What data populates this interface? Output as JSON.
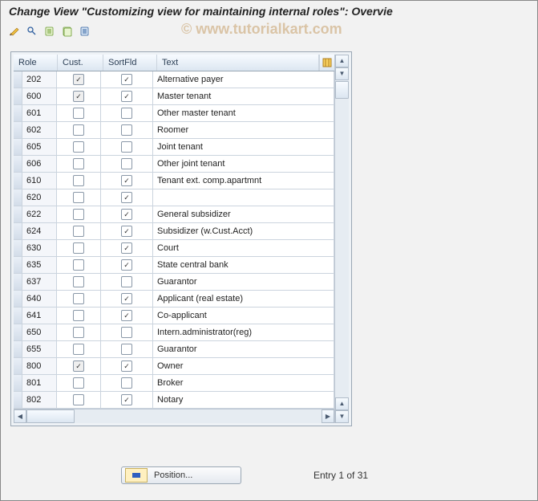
{
  "title": "Change View \"Customizing view for maintaining internal roles\": Overvie",
  "watermark": "© www.tutorialkart.com",
  "toolbar": {
    "items": [
      {
        "name": "toggle-change-icon"
      },
      {
        "name": "new-entries-icon"
      },
      {
        "name": "copy-as-icon"
      },
      {
        "name": "save-icon"
      },
      {
        "name": "select-all-icon"
      }
    ]
  },
  "columns": {
    "role": "Role",
    "cust": "Cust.",
    "sort": "SortFld",
    "text": "Text"
  },
  "rows": [
    {
      "role": "202",
      "cust": true,
      "cust_disabled": true,
      "sort": true,
      "text": "Alternative payer"
    },
    {
      "role": "600",
      "cust": true,
      "cust_disabled": true,
      "sort": true,
      "text": "Master tenant"
    },
    {
      "role": "601",
      "cust": false,
      "sort": false,
      "text": "Other master tenant"
    },
    {
      "role": "602",
      "cust": false,
      "sort": false,
      "text": "Roomer"
    },
    {
      "role": "605",
      "cust": false,
      "sort": false,
      "text": "Joint tenant"
    },
    {
      "role": "606",
      "cust": false,
      "sort": false,
      "text": "Other joint tenant"
    },
    {
      "role": "610",
      "cust": false,
      "sort": true,
      "text": "Tenant ext. comp.apartmnt"
    },
    {
      "role": "620",
      "cust": false,
      "sort": true,
      "text": ""
    },
    {
      "role": "622",
      "cust": false,
      "sort": true,
      "text": "General subsidizer"
    },
    {
      "role": "624",
      "cust": false,
      "sort": true,
      "text": "Subsidizer (w.Cust.Acct)"
    },
    {
      "role": "630",
      "cust": false,
      "sort": true,
      "text": "Court"
    },
    {
      "role": "635",
      "cust": false,
      "sort": true,
      "text": "State central bank"
    },
    {
      "role": "637",
      "cust": false,
      "sort": false,
      "text": "Guarantor"
    },
    {
      "role": "640",
      "cust": false,
      "sort": true,
      "text": "Applicant (real estate)"
    },
    {
      "role": "641",
      "cust": false,
      "sort": true,
      "text": "Co-applicant"
    },
    {
      "role": "650",
      "cust": false,
      "sort": false,
      "text": "Intern.administrator(reg)"
    },
    {
      "role": "655",
      "cust": false,
      "sort": false,
      "text": "Guarantor"
    },
    {
      "role": "800",
      "cust": true,
      "cust_disabled": true,
      "sort": true,
      "text": "Owner"
    },
    {
      "role": "801",
      "cust": false,
      "sort": false,
      "text": "Broker"
    },
    {
      "role": "802",
      "cust": false,
      "sort": true,
      "text": "Notary"
    }
  ],
  "footer": {
    "position": "Position...",
    "entry": "Entry 1 of 31"
  }
}
